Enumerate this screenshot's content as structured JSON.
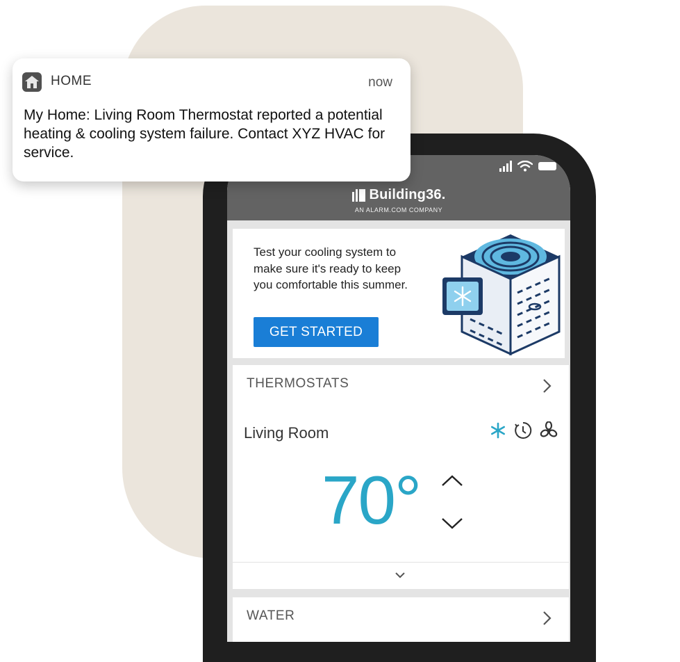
{
  "notification": {
    "app_name": "HOME",
    "time": "now",
    "message": "My Home: Living Room Thermostat reported a potential heating & cooling system failure. Contact XYZ HVAC for service."
  },
  "app": {
    "brand_name": "Building36.",
    "brand_tagline": "AN ALARM.COM COMPANY"
  },
  "promo": {
    "text": "Test your cooling system to make sure it's ready to keep you comfortable this summer.",
    "button_label": "GET STARTED"
  },
  "thermostats": {
    "section_title": "THERMOSTATS",
    "room_name": "Living Room",
    "temperature": "70°",
    "mode_icons": [
      "snowflake-icon",
      "schedule-clock-icon",
      "fan-icon"
    ],
    "active_color": "#2aa6c7"
  },
  "water": {
    "section_title": "WATER"
  },
  "colors": {
    "primary_button": "#1a7ed6",
    "header_bg": "#636363",
    "backdrop": "#ebe5dc"
  }
}
